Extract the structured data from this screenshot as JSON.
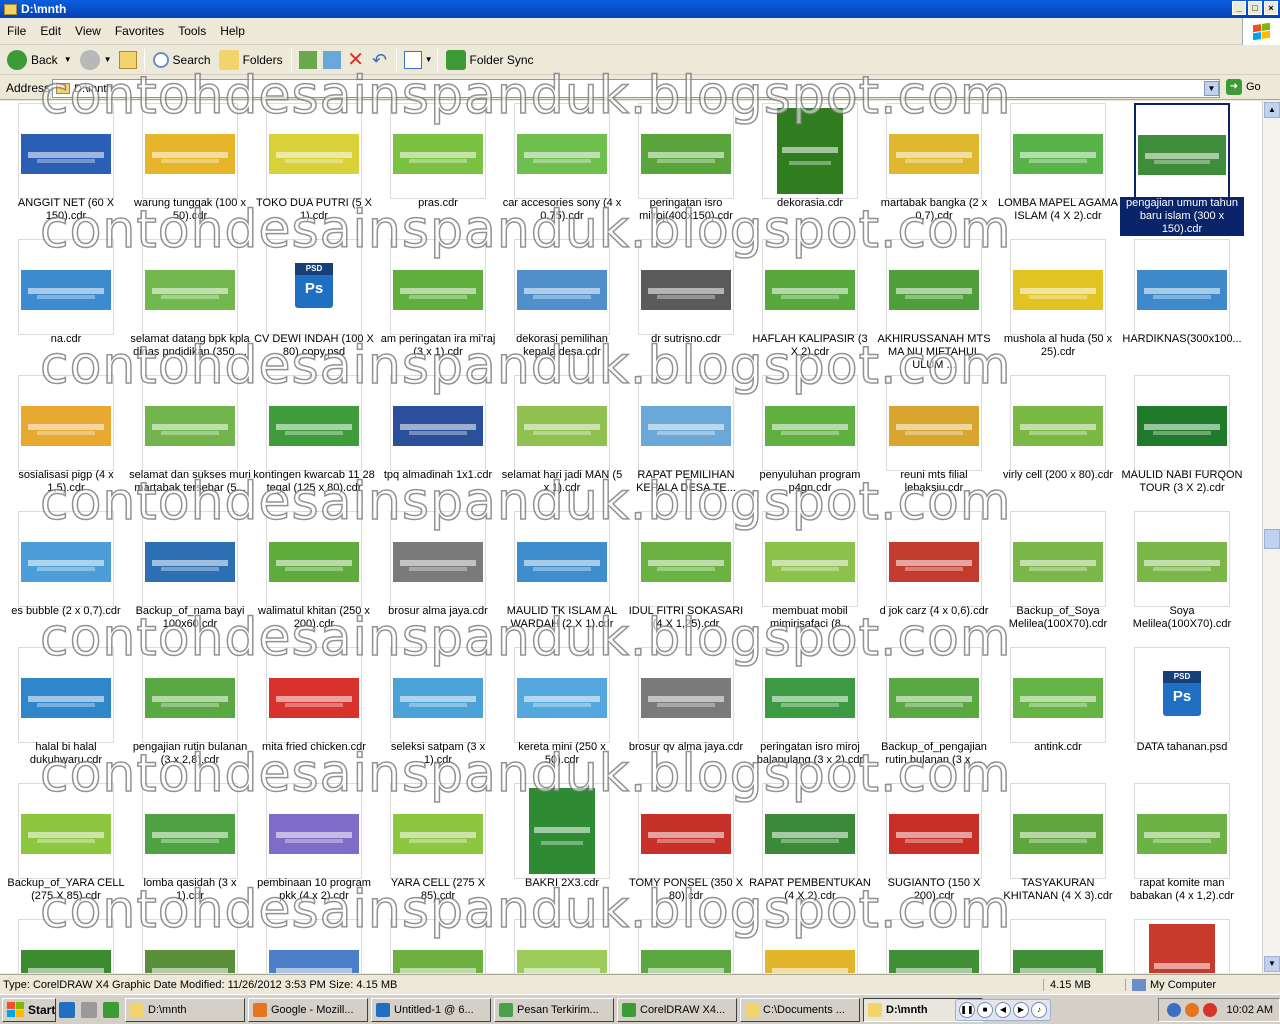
{
  "window": {
    "title": "D:\\mnth"
  },
  "menu": [
    "File",
    "Edit",
    "View",
    "Favorites",
    "Tools",
    "Help"
  ],
  "toolbar": {
    "back": "Back",
    "search": "Search",
    "folders": "Folders",
    "folder_sync": "Folder Sync"
  },
  "address": {
    "label": "Address",
    "value": "D:\\mnth",
    "go": "Go"
  },
  "watermark": "contohdesainspanduk.blogspot.com",
  "files": [
    {
      "name": "ANGGIT NET (60 X 150).cdr",
      "thumb": "#2b5fb5"
    },
    {
      "name": "warung tunggak (100 x 50).cdr",
      "thumb": "#e7b52a"
    },
    {
      "name": "TOKO DUA PUTRI (5 X 1).cdr",
      "thumb": "#d8d13a"
    },
    {
      "name": "pras.cdr",
      "thumb": "#7cc242"
    },
    {
      "name": "car accesories sony (4 x 0,75).cdr",
      "thumb": "#6fbf4f"
    },
    {
      "name": "peringatan isro mi'roj(400x150).cdr",
      "thumb": "#5aa53b"
    },
    {
      "name": "dekorasia.cdr",
      "thumb": "#2f7d1f",
      "tall": true
    },
    {
      "name": "martabak bangka (2 x 0,7).cdr",
      "thumb": "#e0b830"
    },
    {
      "name": "LOMBA MAPEL AGAMA ISLAM (4 X 2).cdr",
      "thumb": "#58b448"
    },
    {
      "name": "pengajian umum tahun baru islam (300 x 150).cdr",
      "thumb": "#3f8c3a",
      "selected": true
    },
    {
      "name": "na.cdr",
      "thumb": "#3c8bd0"
    },
    {
      "name": "selamat datang bpk kpla dinas pndidikan (350 ...",
      "thumb": "#73b84e"
    },
    {
      "name": "CV DEWI INDAH (100 X 80) copy.psd",
      "psd": true
    },
    {
      "name": "am peringatan ira mi'raj (3 x 1).cdr",
      "thumb": "#5fae3e"
    },
    {
      "name": "dekorasi pemilihan kepala desa.cdr",
      "thumb": "#4f8fcc"
    },
    {
      "name": "dr sutrisno.cdr",
      "thumb": "#5a5a5a"
    },
    {
      "name": "HAFLAH KALIPASIR (3 X 2).cdr",
      "thumb": "#57a83d"
    },
    {
      "name": "AKHIRUSSANAH MTS MA NU MIFTAHUL ULUM ...",
      "thumb": "#4f9e3a"
    },
    {
      "name": "mushola al huda (50 x 25).cdr",
      "thumb": "#e2c324"
    },
    {
      "name": "HARDIKNAS(300x100...",
      "thumb": "#3d89c9"
    },
    {
      "name": "sosialisasi pigp (4 x 1,5).cdr",
      "thumb": "#e8a930"
    },
    {
      "name": "selamat dan sukses muri martabak tersebar (5...",
      "thumb": "#72b54c"
    },
    {
      "name": "kontingen kwarcab 11 28 tegal (125 x 80).cdr",
      "thumb": "#3e9c3a"
    },
    {
      "name": "tpq almadinah 1x1.cdr",
      "thumb": "#2b4f9a"
    },
    {
      "name": "selamat hari jadi MAN (5 x 1).cdr",
      "thumb": "#8fc050"
    },
    {
      "name": "RAPAT PEMILIHAN KEPALA DESA TE...",
      "thumb": "#6aa8d8"
    },
    {
      "name": "penyuluhan program p4gn.cdr",
      "thumb": "#5fb03e"
    },
    {
      "name": "reuni mts filial lebaksiu.cdr",
      "thumb": "#d8a52f"
    },
    {
      "name": "virly cell (200 x 80).cdr",
      "thumb": "#79b944"
    },
    {
      "name": "MAULID NABI FURQON TOUR (3 X 2).cdr",
      "thumb": "#1f7a2a"
    },
    {
      "name": "es bubble (2 x 0,7).cdr",
      "thumb": "#4c9ed8"
    },
    {
      "name": "Backup_of_nama bayi 100x60.cdr",
      "thumb": "#2d6fb3"
    },
    {
      "name": "walimatul khitan (250 x 200).cdr",
      "thumb": "#5fab3c"
    },
    {
      "name": "brosur alma jaya.cdr",
      "thumb": "#7a7a7a"
    },
    {
      "name": "MAULID TK ISLAM AL WARDAH (2 X 1).cdr",
      "thumb": "#3e8dcc"
    },
    {
      "name": "IDUL FITRI SOKASARI (4 X 1,25).cdr",
      "thumb": "#6bb243"
    },
    {
      "name": "membuat mobil mimirisafaci (8...",
      "thumb": "#8cc24c"
    },
    {
      "name": "d jok carz (4 x 0,6).cdr",
      "thumb": "#c33b2f"
    },
    {
      "name": "Backup_of_Soya Melilea(100X70).cdr",
      "thumb": "#7ab648"
    },
    {
      "name": "Soya Melilea(100X70).cdr",
      "thumb": "#7ab648"
    },
    {
      "name": "halal bi halal dukuhwaru.cdr",
      "thumb": "#2f86c8"
    },
    {
      "name": "pengajian rutin bulanan (3 x 2,8).cdr",
      "thumb": "#5aa842"
    },
    {
      "name": "mita fried chicken.cdr",
      "thumb": "#d8322c"
    },
    {
      "name": "seleksi satpam (3 x 1).cdr",
      "thumb": "#4aa2d6"
    },
    {
      "name": "kereta mini (250 x 50).cdr",
      "thumb": "#54a8de"
    },
    {
      "name": "brosur qv alma jaya.cdr",
      "thumb": "#7a7a7a"
    },
    {
      "name": "peringatan isro miroj balapulang (3 x 2).cdr",
      "thumb": "#3c9a43"
    },
    {
      "name": "Backup_of_pengajian rutin bulanan (3 x ...",
      "thumb": "#5aa842"
    },
    {
      "name": "antink.cdr",
      "thumb": "#66b446"
    },
    {
      "name": "DATA tahanan.psd",
      "psd": true
    },
    {
      "name": "Backup_of_YARA CELL (275 X 85).cdr",
      "thumb": "#8dc63f"
    },
    {
      "name": "lomba qasidah (3 x 1).cdr",
      "thumb": "#4fa241"
    },
    {
      "name": "pembinaan 10 program pkk (4 x 2).cdr",
      "thumb": "#7f6cc8"
    },
    {
      "name": "YARA CELL (275 X 85).cdr",
      "thumb": "#8dc63f"
    },
    {
      "name": "BAKRI 2X3.cdr",
      "thumb": "#2f8a34",
      "tall": true
    },
    {
      "name": "TOMY PONSEL (350 X 80).cdr",
      "thumb": "#c8312a"
    },
    {
      "name": "RAPAT PEMBENTUKAN (4 X 2).cdr",
      "thumb": "#3a8a3a"
    },
    {
      "name": "SUGIANTO (150 X 200).cdr",
      "thumb": "#c83027"
    },
    {
      "name": "TASYAKURAN KHITANAN (4 X 3).cdr",
      "thumb": "#5fa63e"
    },
    {
      "name": "rapat komite man babakan (4 x 1,2).cdr",
      "thumb": "#6cb244"
    },
    {
      "name": "",
      "thumb": "#3a8c2f"
    },
    {
      "name": "",
      "thumb": "#5a8f3a"
    },
    {
      "name": "",
      "thumb": "#4c7fc8"
    },
    {
      "name": "",
      "thumb": "#6eb040"
    },
    {
      "name": "",
      "thumb": "#9ccc5a"
    },
    {
      "name": "",
      "thumb": "#5ca840"
    },
    {
      "name": "",
      "thumb": "#e3b52a"
    },
    {
      "name": "",
      "thumb": "#3f8f34"
    },
    {
      "name": "",
      "thumb": "#3f8f34"
    },
    {
      "name": "",
      "thumb": "#c83a2c",
      "tall": true
    }
  ],
  "status": {
    "info": "Type: CorelDRAW X4 Graphic Date Modified: 11/26/2012 3:53 PM Size: 4.15 MB",
    "size": "4.15 MB",
    "location": "My Computer"
  },
  "taskbar": {
    "start": "Start",
    "tasks": [
      {
        "label": "D:\\mnth",
        "icon": "#f3d36b"
      },
      {
        "label": "Google - Mozill...",
        "icon": "#e5751f"
      },
      {
        "label": "Untitled-1 @ 6...",
        "icon": "#1f6fc2"
      },
      {
        "label": "Pesan Terkirim...",
        "icon": "#4aa04a"
      },
      {
        "label": "CorelDRAW X4...",
        "icon": "#3c9a37"
      },
      {
        "label": "C:\\Documents ...",
        "icon": "#f3d36b"
      },
      {
        "label": "D:\\mnth",
        "icon": "#f3d36b",
        "active": true
      }
    ],
    "clock": "10:02 AM"
  }
}
